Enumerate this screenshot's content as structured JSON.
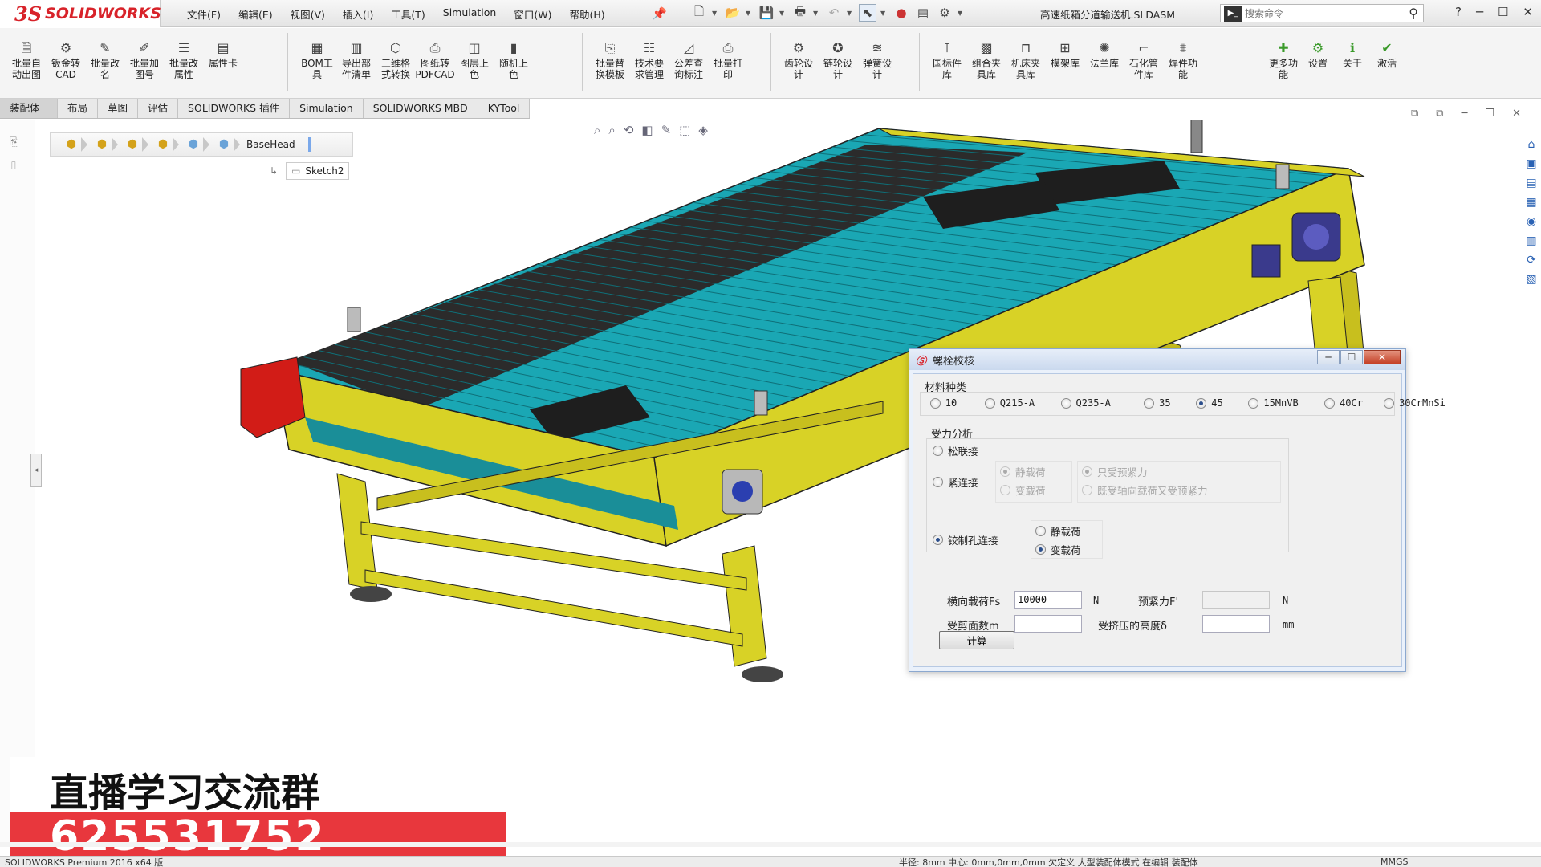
{
  "menubar": {
    "brand_ds": "3S",
    "brand_name": "SOLIDWORKS",
    "menus": [
      "文件(F)",
      "编辑(E)",
      "视图(V)",
      "插入(I)",
      "工具(T)",
      "Simulation",
      "窗口(W)",
      "帮助(H)"
    ],
    "document_title": "高速纸箱分道输送机.SLDASM",
    "search_placeholder": "搜索命令"
  },
  "ribbon": {
    "buttons": [
      {
        "label": "批量自\n动出图",
        "icon": "drawing-icon"
      },
      {
        "label": "钣金转\nCAD",
        "icon": "sheetmetal-icon"
      },
      {
        "label": "批量改\n名",
        "icon": "rename-icon"
      },
      {
        "label": "批量加\n图号",
        "icon": "edit-icon"
      },
      {
        "label": "批量改\n属性",
        "icon": "list-icon"
      },
      {
        "label": "属性卡",
        "icon": "card-icon"
      },
      {
        "label": "BOM工\n具",
        "icon": "bom-icon"
      },
      {
        "label": "导出部\n件清单",
        "icon": "export-icon"
      },
      {
        "label": "三维格\n式转换",
        "icon": "convert-icon"
      },
      {
        "label": "图纸转\nPDFCAD",
        "icon": "pdf-icon"
      },
      {
        "label": "图层上\n色",
        "icon": "layer-icon"
      },
      {
        "label": "随机上\n色",
        "icon": "color-icon"
      },
      {
        "label": "批量替\n换模板",
        "icon": "template-icon"
      },
      {
        "label": "技术要\n求管理",
        "icon": "text-icon"
      },
      {
        "label": "公差查\n询标注",
        "icon": "tolerance-icon"
      },
      {
        "label": "批量打\n印",
        "icon": "print-icon"
      },
      {
        "label": "齿轮设\n计",
        "icon": "gear-icon"
      },
      {
        "label": "链轮设\n计",
        "icon": "sprocket-icon"
      },
      {
        "label": "弹簧设\n计",
        "icon": "spring-icon"
      },
      {
        "label": "国标件\n库",
        "icon": "bolt-icon"
      },
      {
        "label": "组合夹\n具库",
        "icon": "fixture-icon"
      },
      {
        "label": "机床夹\n具库",
        "icon": "clamp-icon"
      },
      {
        "label": "模架库",
        "icon": "mold-icon"
      },
      {
        "label": "法兰库",
        "icon": "flange-icon"
      },
      {
        "label": "石化管\n件库",
        "icon": "pipe-icon"
      },
      {
        "label": "焊件功\n能",
        "icon": "weld-icon"
      },
      {
        "label": "更多功\n能",
        "icon": "plus-icon"
      },
      {
        "label": "设置",
        "icon": "settings-icon"
      },
      {
        "label": "关于",
        "icon": "info-icon"
      },
      {
        "label": "激活",
        "icon": "activate-icon"
      }
    ]
  },
  "tabs": [
    "装配体",
    "布局",
    "草图",
    "评估",
    "SOLIDWORKS 插件",
    "Simulation",
    "SOLIDWORKS MBD",
    "KYTool"
  ],
  "feature_manager": {
    "breadcrumb_label": "BaseHead",
    "sketch_label": "Sketch2"
  },
  "dialog": {
    "title": "螺栓校核",
    "material_group_label": "材料种类",
    "materials": [
      "10",
      "Q215-A",
      "Q235-A",
      "35",
      "45",
      "15MnVB",
      "40Cr",
      "30CrMnSi"
    ],
    "material_selected": "45",
    "force_group_label": "受力分析",
    "loose_label": "松联接",
    "tight_label": "紧连接",
    "tight_static": "静载荷",
    "tight_dynamic": "变载荷",
    "tight_preload_only": "只受预紧力",
    "tight_axial_preload": "既受轴向载荷又受预紧力",
    "reamed_label": "铰制孔连接",
    "reamed_static": "静载荷",
    "reamed_dynamic": "变载荷",
    "field_fs_label": "横向载荷Fs",
    "field_fs_value": "10000",
    "field_fs_unit": "N",
    "field_preload_label": "预紧力F'",
    "field_preload_value": "",
    "field_preload_unit": "N",
    "field_m_label": "受剪面数m",
    "field_m_value": "",
    "field_height_label": "受挤压的高度δ",
    "field_height_value": "",
    "field_height_unit": "mm",
    "calc_label": "计算"
  },
  "overlay": {
    "promo_title": "直播学习交流群",
    "promo_number": "625531752"
  },
  "statusbar": {
    "left": "SOLIDWORKS Premium 2016 x64 版",
    "middle": "半径: 8mm 中心: 0mm,0mm,0mm 欠定义 大型装配体模式 在编辑 装配体",
    "right": "MMGS"
  },
  "colors": {
    "frame_yellow": "#d8d226",
    "roller_teal": "#1aa7b4",
    "belt_dark": "#2b2b2b",
    "motor_red": "#d21c17",
    "bearing_blue": "#3a3a8c",
    "promo_red": "#e8373d",
    "brand_red": "#d8232a"
  }
}
